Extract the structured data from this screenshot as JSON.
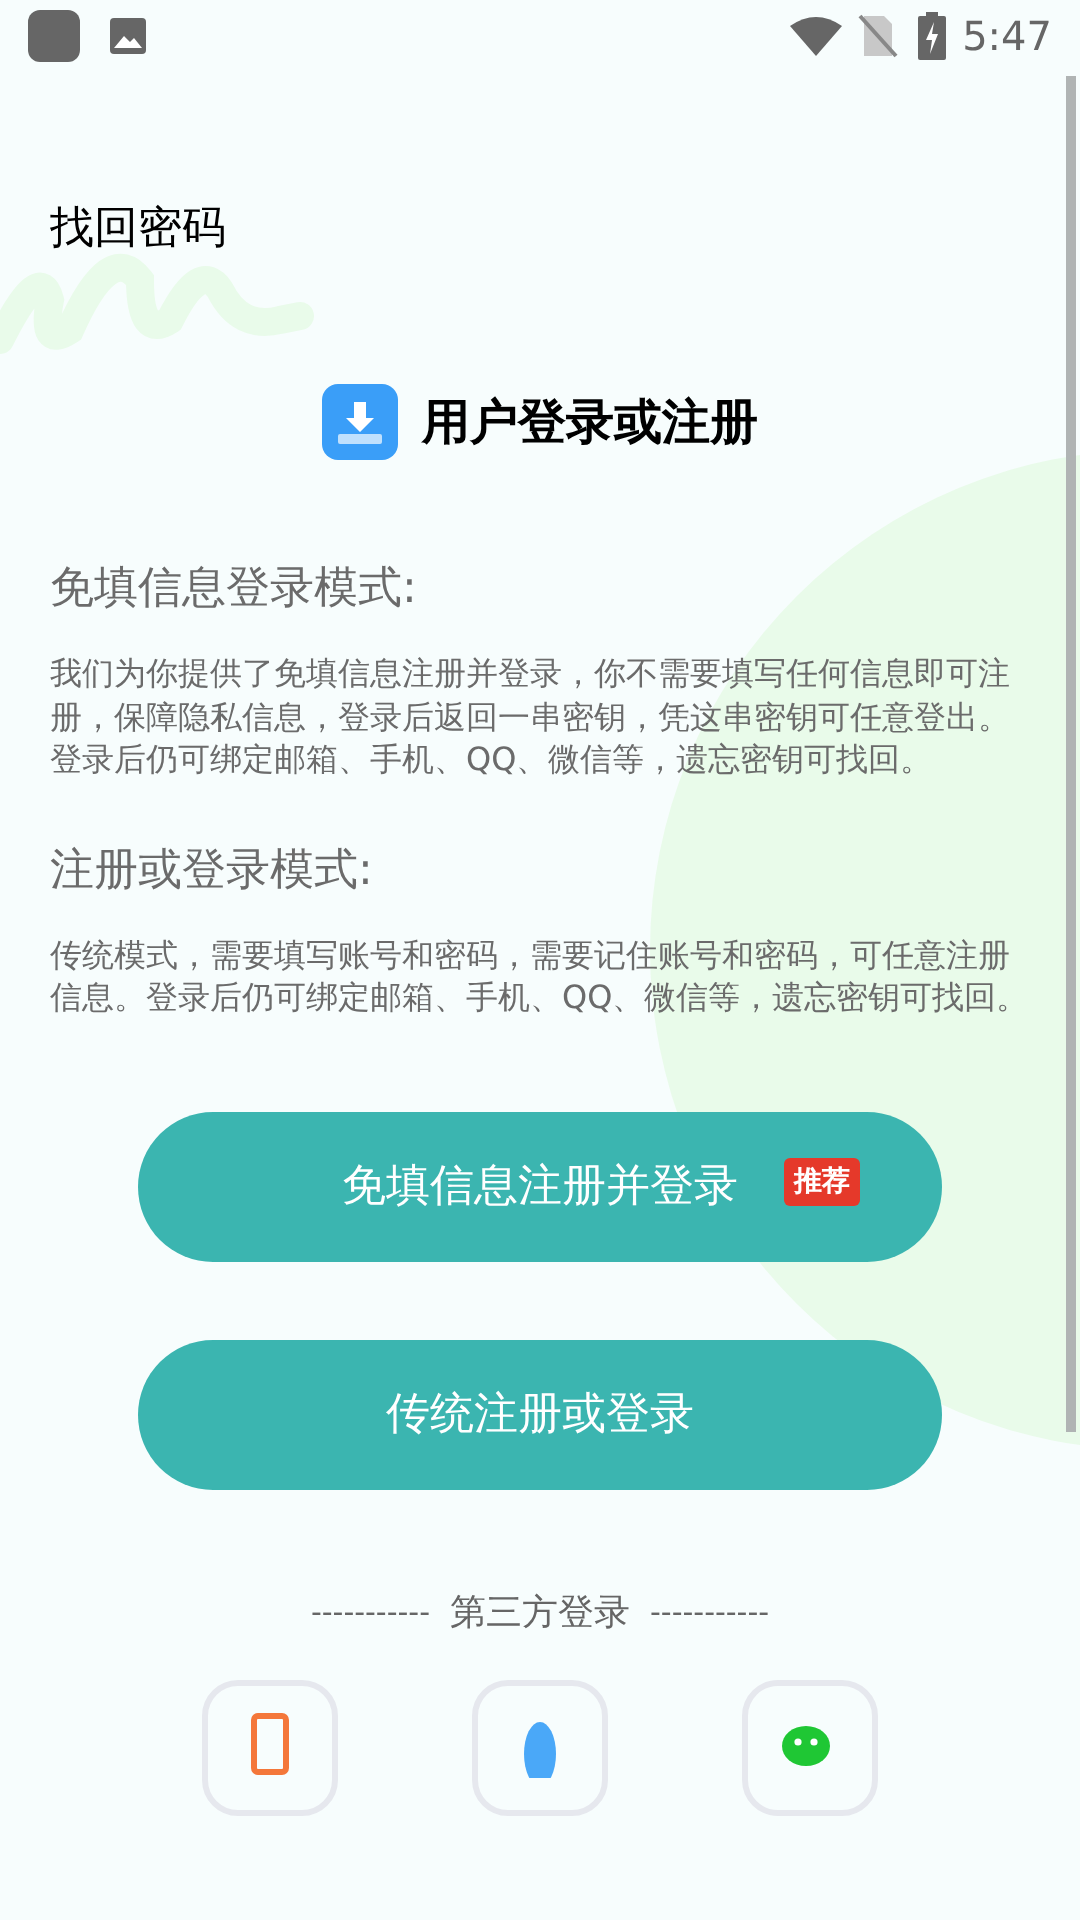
{
  "status_bar": {
    "time": "5:47"
  },
  "top_link": "找回密码",
  "header": {
    "title": "用户登录或注册"
  },
  "sections": [
    {
      "heading": "免填信息登录模式:",
      "body": "我们为你提供了免填信息注册并登录，你不需要填写任何信息即可注册，保障隐私信息，登录后返回一串密钥，凭这串密钥可任意登出。登录后仍可绑定邮箱、手机、QQ、微信等，遗忘密钥可找回。"
    },
    {
      "heading": "注册或登录模式:",
      "body": "传统模式，需要填写账号和密码，需要记住账号和密码，可任意注册信息。登录后仍可绑定邮箱、手机、QQ、微信等，遗忘密钥可找回。"
    }
  ],
  "buttons": [
    {
      "label": "免填信息注册并登录",
      "badge": "推荐"
    },
    {
      "label": "传统注册或登录"
    }
  ],
  "third_party": {
    "dashes_left": "-----------",
    "label": "第三方登录",
    "dashes_right": "-----------",
    "options": [
      {
        "kind": "phone"
      },
      {
        "kind": "penguin"
      },
      {
        "kind": "chat"
      }
    ]
  }
}
